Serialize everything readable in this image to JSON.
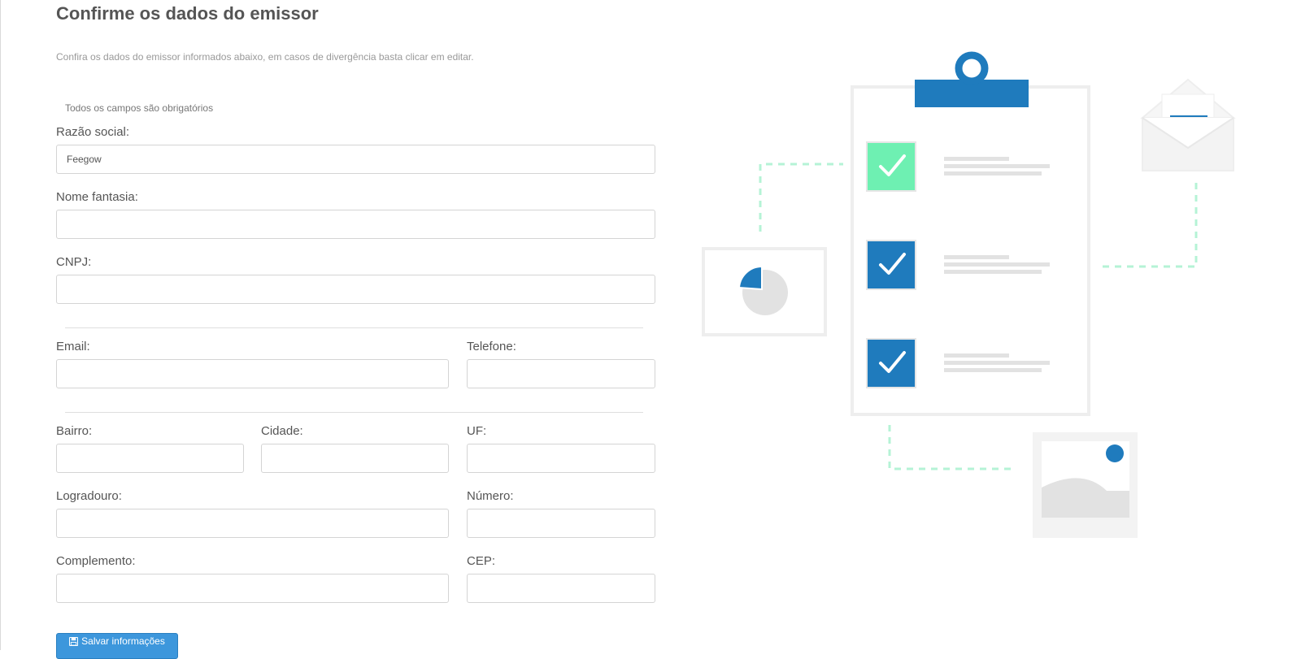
{
  "header": {
    "title": "Confirme os dados do emissor",
    "subtitle": "Confira os dados do emissor informados abaixo, em casos de divergência basta clicar em editar.",
    "required_note": "Todos os campos são obrigatórios"
  },
  "form": {
    "razao_social": {
      "label": "Razão social:",
      "value": "Feegow"
    },
    "nome_fantasia": {
      "label": "Nome fantasia:",
      "value": ""
    },
    "cnpj": {
      "label": "CNPJ:",
      "value": ""
    },
    "email": {
      "label": "Email:",
      "value": ""
    },
    "telefone": {
      "label": "Telefone:",
      "value": ""
    },
    "bairro": {
      "label": "Bairro:",
      "value": ""
    },
    "cidade": {
      "label": "Cidade:",
      "value": ""
    },
    "uf": {
      "label": "UF:",
      "value": ""
    },
    "logradouro": {
      "label": "Logradouro:",
      "value": ""
    },
    "numero": {
      "label": "Número:",
      "value": ""
    },
    "complemento": {
      "label": "Complemento:",
      "value": ""
    },
    "cep": {
      "label": "CEP:",
      "value": ""
    }
  },
  "actions": {
    "save_label": "Salvar informações",
    "save_icon": "floppy-disk-icon"
  },
  "colors": {
    "primary": "#1f7bbd",
    "accent_green": "#6ef0b2",
    "button": "#3d97dc"
  }
}
